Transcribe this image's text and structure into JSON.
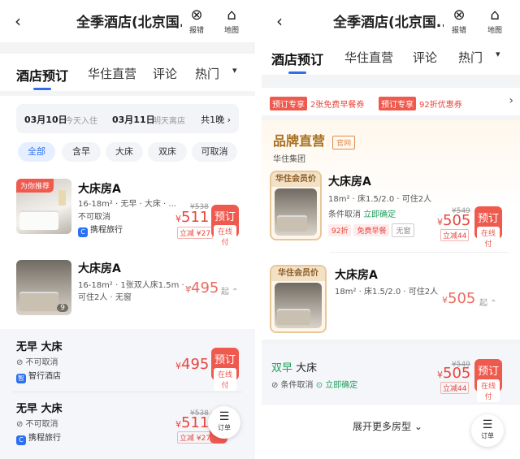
{
  "left": {
    "title": "全季酒店(北京国...",
    "header_icons": [
      {
        "glyph": "⊗",
        "label": "报错"
      },
      {
        "glyph": "⌂",
        "label": "地图"
      }
    ],
    "tabs": [
      "酒店预订",
      "华住直营",
      "评论",
      "热门"
    ],
    "tab_more": "▾",
    "date": {
      "in": "03月10日",
      "in_sub": "今天入住",
      "out": "03月11日",
      "out_sub": "明天离店",
      "nights": "共1晚 ›"
    },
    "chips": [
      "全部",
      "含早",
      "大床",
      "双床",
      "可取消"
    ],
    "rooms": [
      {
        "tag": "为你推荐",
        "name": "大床房A",
        "info1": "16-18m² · 无早 · 大床 · ...",
        "info2": "不可取消",
        "supplier": "携程旅行",
        "old": "¥538",
        "price": "511",
        "saved": "立减 ¥27",
        "book": "预订",
        "pay": "在线付"
      },
      {
        "name": "大床房A",
        "info1": "16-18m² · 1张双人床1.5m · ...",
        "info2": "可住2人 · 无窗",
        "price": "495",
        "qi": "起 ⌃",
        "count": "9"
      }
    ],
    "offers": [
      {
        "name": "无早  大床",
        "cancel": "⊘ 不可取消",
        "supplier": "智行酒店",
        "price": "495",
        "book": "预订",
        "pay": "在线付"
      },
      {
        "name": "无早  大床",
        "cancel": "⊘ 不可取消",
        "supplier": "携程旅行",
        "old": "¥538",
        "price": "511",
        "saved": "立减 ¥27",
        "book": "预订"
      }
    ],
    "fab": {
      "glyph": "☰",
      "label": "订单"
    }
  },
  "right": {
    "title": "全季酒店(北京国...",
    "header_icons": [
      {
        "glyph": "⊗",
        "label": "报错"
      },
      {
        "glyph": "⌂",
        "label": "地图"
      }
    ],
    "tabs": [
      "酒店预订",
      "华住直营",
      "评论",
      "热门"
    ],
    "tab_more": "▾",
    "promos": [
      {
        "tag": "预订专享",
        "text": "2张免费早餐券"
      },
      {
        "tag": "预订专享",
        "text": "92折优惠券"
      }
    ],
    "brand": {
      "title": "品牌直营",
      "badge": "官网",
      "group": "华住集团"
    },
    "rooms": [
      {
        "vip": "华住会员价",
        "name": "大床房A",
        "info1": "18m² · 床1.5/2.0 · 可住2人",
        "cancel": "条件取消",
        "confirm": "立即确定",
        "tags": [
          "92折",
          "免费早餐",
          "无窗"
        ],
        "old": "¥549",
        "price": "505",
        "saved": "立减44",
        "book": "预订",
        "pay": "在线付"
      },
      {
        "vip": "华住会员价",
        "name": "大床房A",
        "info1": "18m² · 床1.5/2.0 · 可住2人",
        "price": "505",
        "qi": "起 ⌃"
      }
    ],
    "offer": {
      "breakfast": "双早",
      "bed": "大床",
      "cancel": "⊘ 条件取消",
      "confirm": "⊙ 立即确定",
      "old": "¥549",
      "price": "505",
      "saved": "立减44",
      "book": "预订",
      "pay": "在线付"
    },
    "more": "展开更多房型 ⌄",
    "fab": {
      "glyph": "☰",
      "label": "订单"
    }
  }
}
